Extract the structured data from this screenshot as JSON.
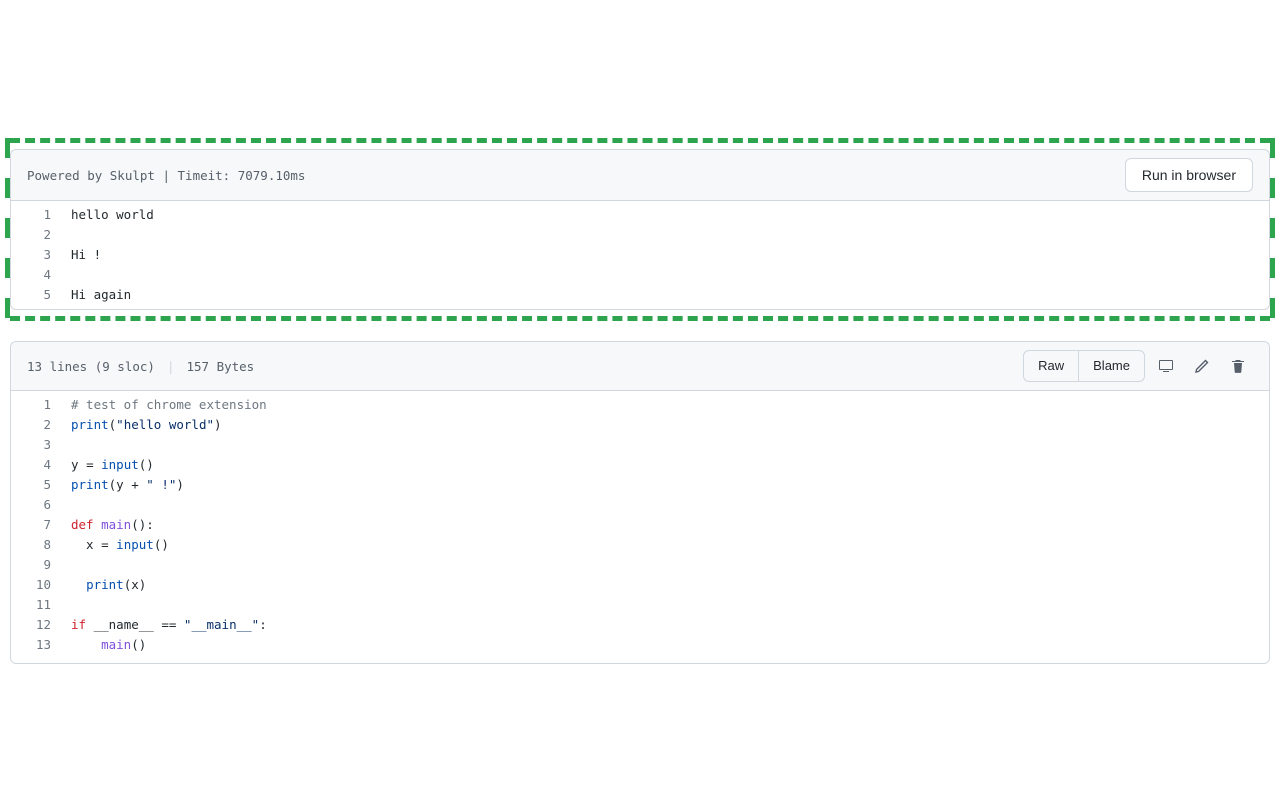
{
  "output_panel": {
    "header_text": "Powered by Skulpt | Timeit: 7079.10ms",
    "run_button_label": "Run in browser",
    "lines": [
      {
        "n": "1",
        "text": "hello world"
      },
      {
        "n": "2",
        "text": ""
      },
      {
        "n": "3",
        "text": "Hi !"
      },
      {
        "n": "4",
        "text": ""
      },
      {
        "n": "5",
        "text": "Hi again"
      }
    ]
  },
  "source_panel": {
    "stats_lines": "13 lines (9 sloc)",
    "stats_bytes": "157 Bytes",
    "raw_label": "Raw",
    "blame_label": "Blame",
    "code": [
      {
        "n": "1",
        "tokens": [
          [
            "c",
            "# test of chrome extension"
          ]
        ]
      },
      {
        "n": "2",
        "tokens": [
          [
            "nb",
            "print"
          ],
          [
            "op",
            "("
          ],
          [
            "s",
            "\"hello world\""
          ],
          [
            "op",
            ")"
          ]
        ]
      },
      {
        "n": "3",
        "tokens": []
      },
      {
        "n": "4",
        "tokens": [
          [
            "nv",
            "y "
          ],
          [
            "op",
            "="
          ],
          [
            "nv",
            " "
          ],
          [
            "nb",
            "input"
          ],
          [
            "op",
            "()"
          ]
        ]
      },
      {
        "n": "5",
        "tokens": [
          [
            "nb",
            "print"
          ],
          [
            "op",
            "("
          ],
          [
            "nv",
            "y "
          ],
          [
            "op",
            "+"
          ],
          [
            "nv",
            " "
          ],
          [
            "s",
            "\" !\""
          ],
          [
            "op",
            ")"
          ]
        ]
      },
      {
        "n": "6",
        "tokens": []
      },
      {
        "n": "7",
        "tokens": [
          [
            "k",
            "def"
          ],
          [
            "nv",
            " "
          ],
          [
            "nf",
            "main"
          ],
          [
            "op",
            "():"
          ]
        ]
      },
      {
        "n": "8",
        "tokens": [
          [
            "nv",
            "  x "
          ],
          [
            "op",
            "="
          ],
          [
            "nv",
            " "
          ],
          [
            "nb",
            "input"
          ],
          [
            "op",
            "()"
          ]
        ]
      },
      {
        "n": "9",
        "tokens": []
      },
      {
        "n": "10",
        "tokens": [
          [
            "nv",
            "  "
          ],
          [
            "nb",
            "print"
          ],
          [
            "op",
            "("
          ],
          [
            "nv",
            "x"
          ],
          [
            "op",
            ")"
          ]
        ]
      },
      {
        "n": "11",
        "tokens": []
      },
      {
        "n": "12",
        "tokens": [
          [
            "k",
            "if"
          ],
          [
            "nv",
            " __name__ "
          ],
          [
            "op",
            "=="
          ],
          [
            "nv",
            " "
          ],
          [
            "s",
            "\"__main__\""
          ],
          [
            "op",
            ":"
          ]
        ]
      },
      {
        "n": "13",
        "tokens": [
          [
            "nv",
            "    "
          ],
          [
            "nf",
            "main"
          ],
          [
            "op",
            "()"
          ]
        ]
      }
    ]
  }
}
